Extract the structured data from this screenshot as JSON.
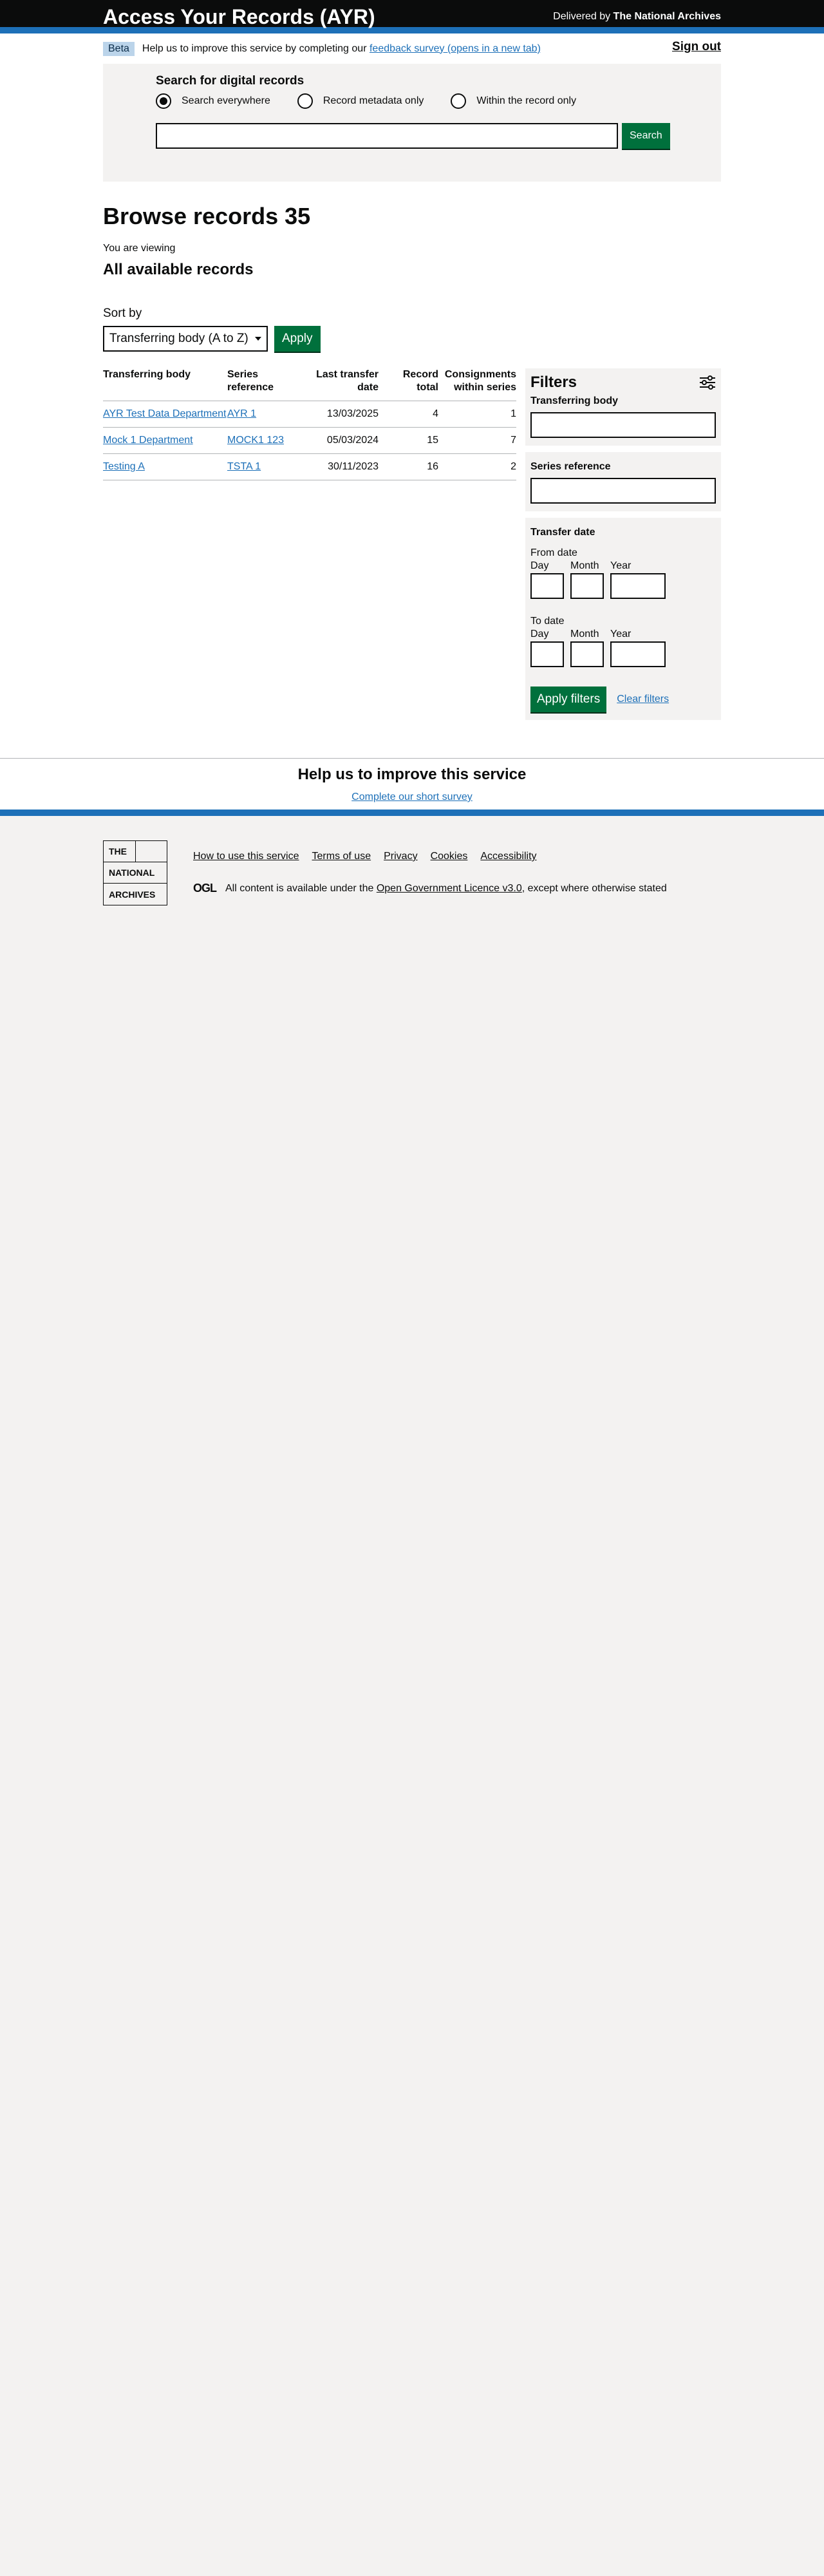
{
  "header": {
    "title": "Access Your Records (AYR)",
    "delivered_prefix": "Delivered by ",
    "delivered_org": "The National Archives"
  },
  "beta": {
    "tag": "Beta",
    "text": "Help us to improve this service by completing our ",
    "link": "feedback survey (opens in a new tab)",
    "sign_out": "Sign out"
  },
  "search": {
    "label": "Search for digital records",
    "options": [
      "Search everywhere",
      "Record metadata only",
      "Within the record only"
    ],
    "selected": "Search everywhere",
    "value": "",
    "button": "Search"
  },
  "main": {
    "heading": "Browse records 35",
    "viewing": "You are viewing",
    "subheading": "All available records",
    "sort_label": "Sort by",
    "sort_value": "Transferring body (A to Z)",
    "apply": "Apply"
  },
  "table": {
    "headers": [
      "Transferring body",
      "Series reference",
      "Last transfer date",
      "Record total",
      "Consignments within series"
    ],
    "rows": [
      [
        "AYR Test Data Department",
        "AYR 1",
        "13/03/2025",
        "4",
        "1"
      ],
      [
        "Mock 1 Department",
        "MOCK1 123",
        "05/03/2024",
        "15",
        "7"
      ],
      [
        "Testing A",
        "TSTA 1",
        "30/11/2023",
        "16",
        "2"
      ]
    ]
  },
  "filters": {
    "title": "Filters",
    "transferring_body": "Transferring body",
    "series_reference": "Series reference",
    "transfer_date": "Transfer date",
    "from_date": "From date",
    "to_date": "To date",
    "day": "Day",
    "month": "Month",
    "year": "Year",
    "apply": "Apply filters",
    "clear": "Clear filters"
  },
  "help": {
    "title": "Help us to improve this service",
    "link": "Complete our short survey"
  },
  "footer": {
    "logo": [
      "THE",
      "NATIONAL",
      "ARCHIVES"
    ],
    "links": [
      "How to use this service",
      "Terms of use",
      "Privacy",
      "Cookies",
      "Accessibility"
    ],
    "ogl_mark": "OGL",
    "licence_prefix": "All content is available under the ",
    "licence_link": "Open Government Licence v3.0",
    "licence_suffix": ", except where otherwise stated"
  }
}
